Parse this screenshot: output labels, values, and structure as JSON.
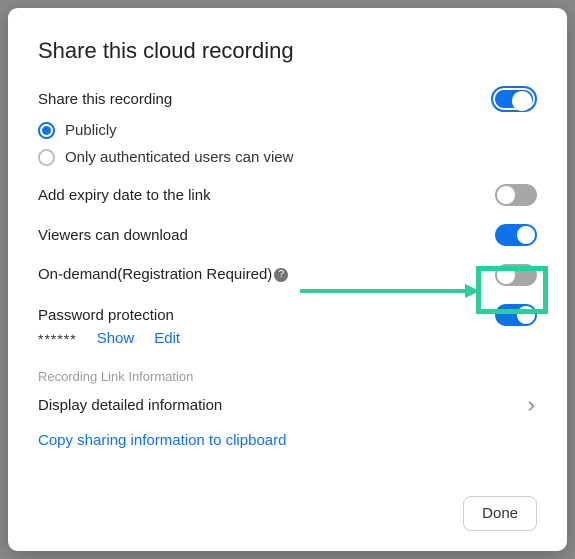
{
  "title": "Share this cloud recording",
  "share": {
    "label": "Share this recording",
    "enabled": true,
    "options": {
      "publicly": "Publicly",
      "authenticated": "Only authenticated users can view",
      "selected": "publicly"
    }
  },
  "settings": {
    "expiry": {
      "label": "Add expiry date to the link",
      "enabled": false
    },
    "download": {
      "label": "Viewers can download",
      "enabled": true
    },
    "ondemand": {
      "label": "On-demand(Registration Required)",
      "enabled": false
    },
    "password": {
      "label": "Password protection",
      "enabled": true,
      "mask": "******",
      "show": "Show",
      "edit": "Edit"
    }
  },
  "recording_link": {
    "section_label": "Recording Link Information",
    "display_label": "Display detailed information",
    "copy_label": "Copy sharing information to clipboard"
  },
  "footer": {
    "done": "Done"
  },
  "icons": {
    "help": "?"
  },
  "annotation": {
    "color": "#2ecc9b"
  }
}
